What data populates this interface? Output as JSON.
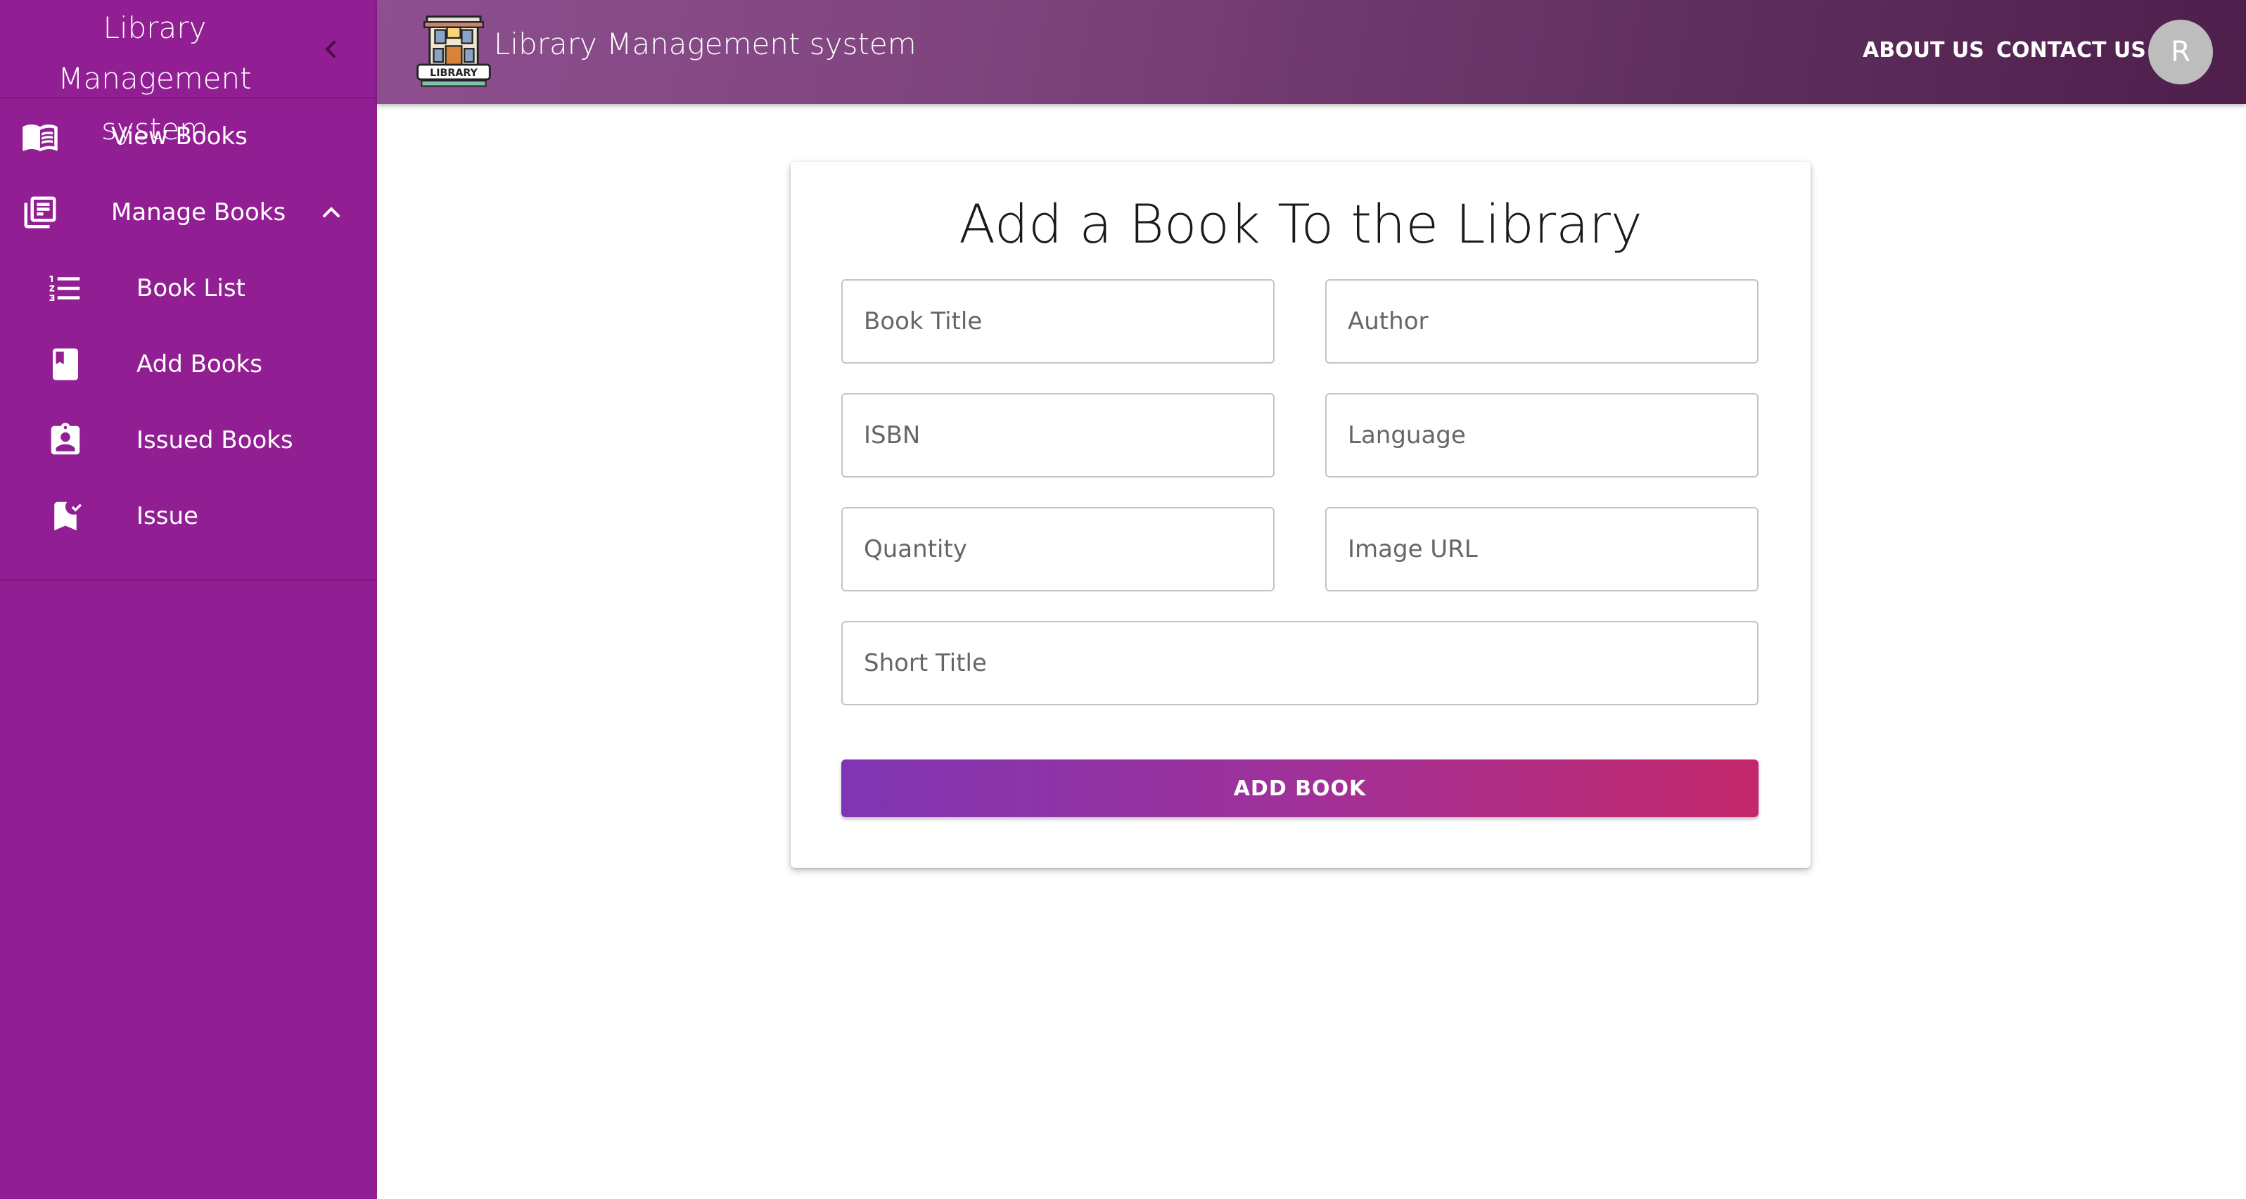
{
  "sidebar": {
    "title": "Library Management system",
    "items": [
      {
        "label": "View Books",
        "icon": "open-book-icon"
      },
      {
        "label": "Manage Books",
        "icon": "library-books-icon",
        "expanded": true
      },
      {
        "label": "Book List",
        "icon": "format-list-numbered-icon"
      },
      {
        "label": "Add Books",
        "icon": "book-icon"
      },
      {
        "label": "Issued Books",
        "icon": "assignment-ind-icon"
      },
      {
        "label": "Issue",
        "icon": "bookmark-added-icon"
      }
    ]
  },
  "header": {
    "title": "Library Management system",
    "logo_text": "LIBRARY",
    "about_label": "ABOUT US",
    "contact_label": "CONTACT US",
    "avatar_initial": "R"
  },
  "form": {
    "title": "Add a Book To the Library",
    "fields": {
      "book_title": {
        "placeholder": "Book Title",
        "value": ""
      },
      "author": {
        "placeholder": "Author",
        "value": ""
      },
      "isbn": {
        "placeholder": "ISBN",
        "value": ""
      },
      "language": {
        "placeholder": "Language",
        "value": ""
      },
      "quantity": {
        "placeholder": "Quantity",
        "value": ""
      },
      "image_url": {
        "placeholder": "Image URL",
        "value": ""
      },
      "short_title": {
        "placeholder": "Short Title",
        "value": ""
      }
    },
    "submit_label": "ADD BOOK"
  },
  "colors": {
    "sidebar_bg": "#921e93",
    "topbar_start": "#8d4f8f",
    "topbar_end": "#4e1f4c",
    "button_start": "#7f35b3",
    "button_end": "#c4286b",
    "avatar_bg": "#bdbdbd"
  }
}
